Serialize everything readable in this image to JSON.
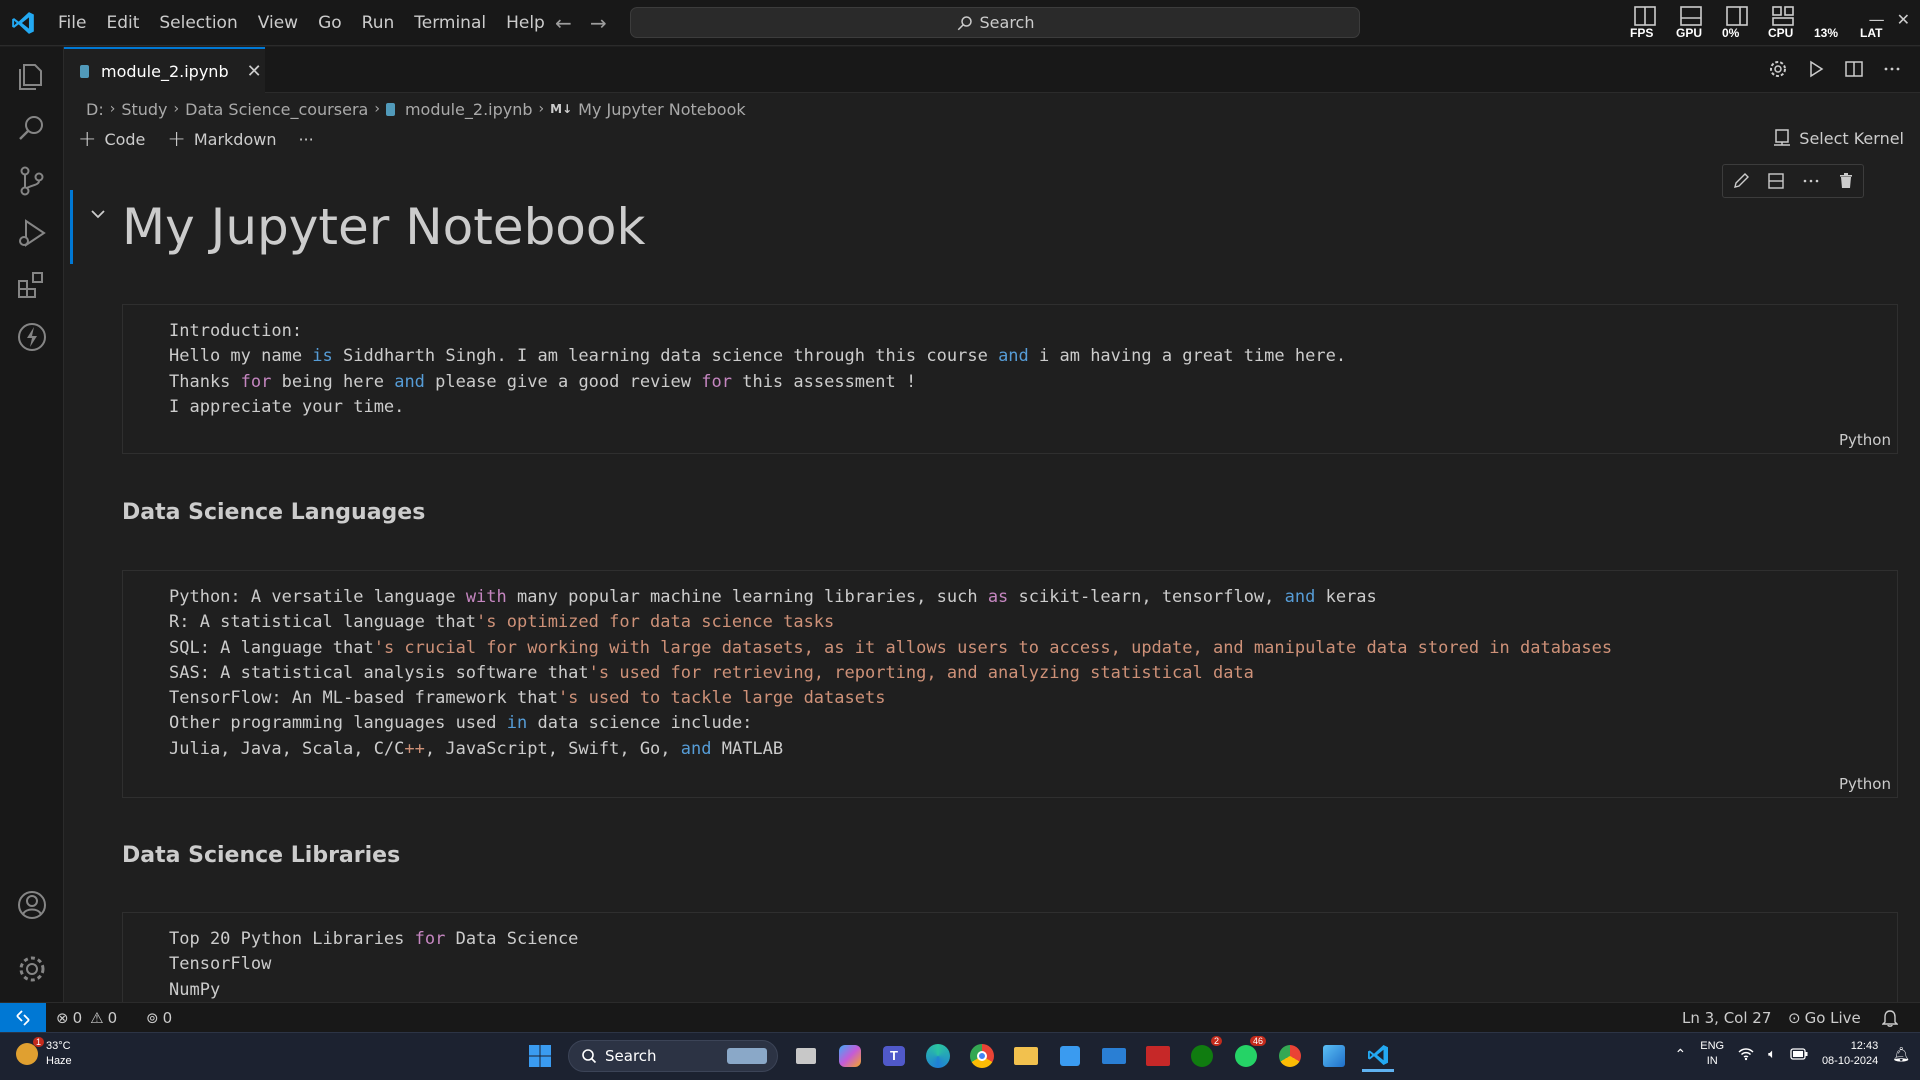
{
  "titlebar": {
    "menu": [
      "File",
      "Edit",
      "Selection",
      "View",
      "Go",
      "Run",
      "Terminal",
      "Help"
    ],
    "search_label": "Search",
    "perf_labels": [
      "FPS",
      "GPU",
      "0%",
      "CPU",
      "13%",
      "LAT"
    ]
  },
  "tab": {
    "label": "module_2.ipynb",
    "close": "✕"
  },
  "breadcrumb": {
    "drive": "D:",
    "folder1": "Study",
    "folder2": "Data Science_coursera",
    "file": "module_2.ipynb",
    "md_icon": "M↓",
    "section": "My Jupyter Notebook",
    "sep": "›"
  },
  "nb_toolbar": {
    "code_label": "Code",
    "markdown_label": "Markdown",
    "more_label": "···",
    "kernel_label": "Select Kernel"
  },
  "notebook": {
    "title": "My Jupyter Notebook",
    "cells": [
      {
        "lines": [
          "Introduction:",
          "Hello my name is Siddharth Singh. I am learning data science through this course and i am having a great time here.",
          "Thanks for being here and please give a good review for this assessment !",
          "I appreciate your time."
        ],
        "language": "Python"
      },
      {
        "heading": "Data Science Languages"
      },
      {
        "lines": [
          "Python: A versatile language with many popular machine learning libraries, such as scikit-learn, tensorflow, and keras",
          "R: A statistical language that's optimized for data science tasks",
          "SQL: A language that's crucial for working with large datasets, as it allows users to access, update, and manipulate data stored in databases",
          "SAS: A statistical analysis software that's used for retrieving, reporting, and analyzing statistical data",
          "TensorFlow: An ML-based framework that's used to tackle large datasets",
          "Other programming languages used in data science include:",
          "Julia, Java, Scala, C/C++, JavaScript, Swift, Go, and MATLAB"
        ],
        "language": "Python"
      },
      {
        "heading": "Data Science Libraries"
      },
      {
        "lines": [
          "Top 20 Python Libraries for Data Science",
          "TensorFlow",
          "NumPy"
        ]
      }
    ]
  },
  "statusbar": {
    "errors": "0",
    "warnings": "0",
    "ports": "0",
    "position": "Ln 3, Col 27",
    "go_live": "Go Live"
  },
  "taskbar": {
    "weather_temp": "33°C",
    "weather_desc": "Haze",
    "weather_badge": "1",
    "search_label": "Search",
    "xbox_badge": "2",
    "whatsapp_badge": "46",
    "lang_top": "ENG",
    "lang_bottom": "IN",
    "time": "12:43",
    "date": "08-10-2024"
  },
  "colors": {
    "accent": "#0078d4",
    "keyword_blue": "#569cd6",
    "keyword_purple": "#c586c0",
    "string_orange": "#ce9178"
  }
}
